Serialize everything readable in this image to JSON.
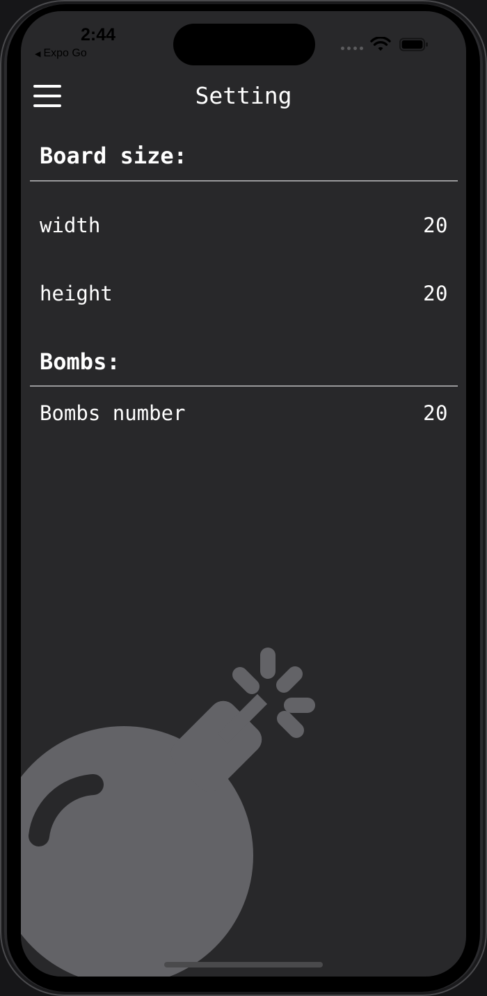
{
  "status_bar": {
    "time": "2:44",
    "back_app": "Expo Go"
  },
  "header": {
    "title": "Setting"
  },
  "sections": [
    {
      "heading": "Board size:",
      "rows": [
        {
          "label": "width",
          "value": "20"
        },
        {
          "label": "height",
          "value": "20"
        }
      ]
    },
    {
      "heading": "Bombs:",
      "rows": [
        {
          "label": "Bombs number",
          "value": "20"
        }
      ]
    }
  ],
  "colors": {
    "background": "#28282a",
    "text": "#ffffff",
    "divider": "#9a9a9c",
    "illustration": "#636367"
  },
  "icons": {
    "menu": "hamburger-menu-icon",
    "illustration": "bomb-icon"
  }
}
